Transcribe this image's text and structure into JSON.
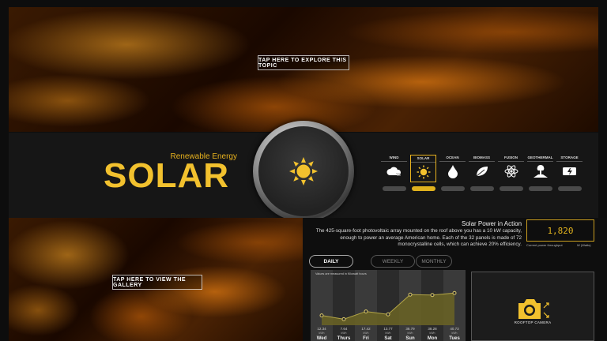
{
  "hero": {
    "explore_label": "TAP HERE TO EXPLORE THIS TOPIC",
    "gallery_label": "TAP HERE TO VIEW THE GALLERY"
  },
  "header": {
    "subtitle": "Renewable Energy",
    "title": "SOLAR"
  },
  "topics": [
    {
      "label": "WIND",
      "icon": "cloud-wind-icon"
    },
    {
      "label": "SOLAR",
      "icon": "sun-icon",
      "active": true
    },
    {
      "label": "OCEAN",
      "icon": "water-drop-icon"
    },
    {
      "label": "BIOMASS",
      "icon": "leaf-icon"
    },
    {
      "label": "FUSION",
      "icon": "atom-icon"
    },
    {
      "label": "GEOTHERMAL",
      "icon": "geyser-icon"
    },
    {
      "label": "STORAGE",
      "icon": "battery-icon"
    }
  ],
  "action": {
    "title": "Solar Power in Action",
    "text": "The 425-square-foot photovoltaic array mounted on the roof above you has a 10 kW capacity, enough to power an average American home. Each of the 32 panels is made of 72 monocrystalline cells, which can achieve 20% efficiency.",
    "counter_value": "1,820",
    "counter_caption": "Current power throughput",
    "counter_unit": "W (Watts)"
  },
  "periods": {
    "daily": "DAILY",
    "weekly": "WEEKLY",
    "monthly": "MONTHLY"
  },
  "chart_data": {
    "type": "area",
    "note": "Values are measured in Kilowatt hours",
    "categories": [
      "Wed",
      "Thurs",
      "Fri",
      "Sat",
      "Sun",
      "Mon",
      "Tues"
    ],
    "values": [
      12.34,
      7.64,
      17.42,
      13.77,
      38.79,
      38.28,
      40.73
    ],
    "value_labels": [
      "12.34",
      "7.64",
      "17.42",
      "13.77",
      "38.79",
      "38.28",
      "40.73"
    ],
    "unit_labels": [
      "kWh",
      "kWh",
      "kWh",
      "kWh",
      "kWh",
      "kWh",
      "kWh"
    ],
    "ylim": [
      0,
      60
    ],
    "colors": {
      "fill": "#6b6425",
      "line": "#b3a547",
      "point": "#d8c66a"
    }
  },
  "camera": {
    "label": "ROOFTOP CAMERA",
    "icon": "camera-icon"
  },
  "colors": {
    "accent": "#e8b21e"
  }
}
